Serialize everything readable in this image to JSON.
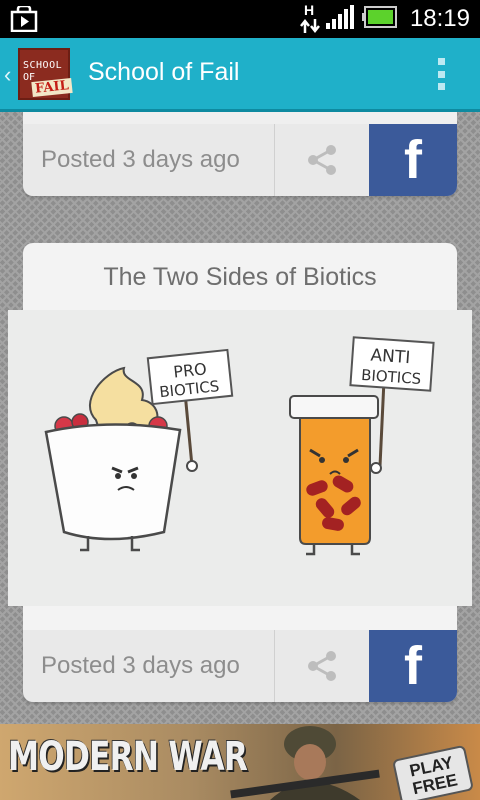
{
  "status_bar": {
    "network_indicator": "H",
    "time": "18:19",
    "icons": [
      "play-store-icon",
      "network-arrows-icon",
      "signal-icon",
      "battery-icon"
    ]
  },
  "action_bar": {
    "logo_line1": "SCHOOL",
    "logo_line2": "OF",
    "logo_line3": "FAIL",
    "title": "School of Fail",
    "back_icon": "chevron-left-icon",
    "menu_icon": "overflow-menu-icon",
    "color": "#1fb0c9"
  },
  "posts": [
    {
      "posted": "Posted 3 days ago",
      "share_icon": "share-icon",
      "facebook_label": "f"
    },
    {
      "title": "The Two Sides of Biotics",
      "image": {
        "left_sign_line1": "PRO",
        "left_sign_line2": "BIOTICS",
        "right_sign_line1": "ANTI",
        "right_sign_line2": "BIOTICS"
      },
      "posted": "Posted 3 days ago",
      "share_icon": "share-icon",
      "facebook_label": "f"
    }
  ],
  "ad": {
    "title": "MODERN WAR",
    "cta_line1": "PLAY",
    "cta_line2": "FREE"
  },
  "colors": {
    "facebook": "#3b5a9a",
    "footer": "#e9e9e9",
    "text_gray": "#8d8d8d"
  }
}
